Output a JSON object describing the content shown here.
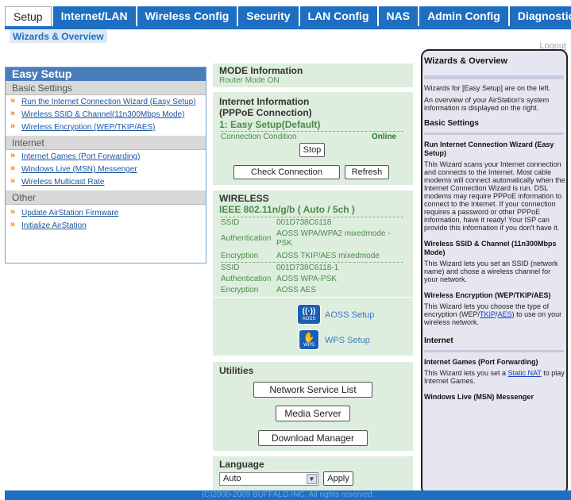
{
  "nav": {
    "tabs": [
      "Setup",
      "Internet/LAN",
      "Wireless Config",
      "Security",
      "LAN Config",
      "NAS",
      "Admin Config",
      "Diagnostic"
    ],
    "active_index": 0,
    "sub_link": "Wizards & Overview",
    "logout": "Logout"
  },
  "easy_setup": {
    "title": "Easy Setup",
    "sections": [
      {
        "title": "Basic Settings",
        "items": [
          "Run the Internet Connection Wizard (Easy Setup)",
          "Wireless SSID & Channel(11n300Mbps Mode)",
          "Wireless Encryption (WEP/TKIP/AES)"
        ]
      },
      {
        "title": "Internet",
        "items": [
          "Internet Games (Port Forwarding)",
          "Windows Live (MSN) Messenger",
          "Wireless Multicast Rate"
        ]
      },
      {
        "title": "Other",
        "items": [
          "Update AirStation Firmware",
          "Initialize AirStation"
        ]
      }
    ]
  },
  "mode": {
    "title": "MODE Information",
    "value": "Router Mode ON"
  },
  "internet": {
    "title_line1": "Internet Information",
    "title_line2": "(PPPoE Connection)",
    "session": "1: Easy Setup(Default)",
    "condition_label": "Connection Condition",
    "condition_value": "Online",
    "stop_button": "Stop",
    "check_button": "Check Connection",
    "refresh_button": "Refresh"
  },
  "wireless": {
    "title": "WIRELESS",
    "mode": "IEEE 802.11n/g/b ( Auto / 5ch )",
    "ssid1_label": "SSID",
    "ssid1": "001D738C6118",
    "auth1_label": "Authentication",
    "auth1": "AOSS WPA/WPA2 mixedmode - PSK",
    "enc1_label": "Encryption",
    "enc1": "AOSS TKIP/AES mixedmode",
    "ssid2_label": "SSID",
    "ssid2": "001D738C6118-1",
    "auth2_label": "Authentication",
    "auth2": "AOSS WPA-PSK",
    "enc2_label": "Encryption",
    "enc2": "AOSS AES",
    "aoss_label": "AOSS Setup",
    "aoss_icon_text": "AOSS",
    "wps_label": "WPS Setup",
    "wps_icon_text": "WPS"
  },
  "utilities": {
    "title": "Utilities",
    "buttons": [
      "Network Service List",
      "Media Server",
      "Download Manager"
    ]
  },
  "language": {
    "title": "Language",
    "selected": "Auto",
    "apply": "Apply"
  },
  "help": {
    "title": "Wizards & Overview",
    "intro1": "Wizards for [Easy Setup] are on the left.",
    "intro2": "An overview of your AirStation's system information is displayed on the right.",
    "basic_heading": "Basic Settings",
    "run_heading": "Run Internet Connection Wizard (Easy Setup)",
    "run_text": "This Wizard scans your Internet connection and connects to the Internet. Most cable modems will connect automatically when the Internet Connection Wizard is run. DSL modems may require PPPoE information to connect to the Internet. If your connection requires a password or other PPPoE information, have it ready! Your ISP can provide this information if you don't have it.",
    "ssid_heading": "Wireless SSID & Channel (11n300Mbps Mode)",
    "ssid_text": "This Wizard lets you set an SSID (network name) and chose a wireless channel for your network.",
    "enc_heading": "Wireless Encryption (WEP/TKIP/AES)",
    "enc_text_a": "This Wizard lets you choose the type of encryption (WEP/",
    "enc_link1": "TKIP",
    "enc_sep": "/",
    "enc_link2": "AES",
    "enc_text_b": ") to use on your wireless network.",
    "internet_heading": "Internet",
    "games_heading": "Internet Games (Port Forwarding)",
    "games_text_a": "This Wizard lets you set a ",
    "games_link": "Static NAT",
    "games_text_b": " to play Internet Games.",
    "msn_heading": "Windows Live (MSN) Messenger"
  },
  "footer": "(C)2000-2009 BUFFALO INC. All rights reserved.",
  "colors": {
    "nav_blue": "#1e6fc1",
    "panel_green": "#deeede",
    "help_bg": "#e6e6f0",
    "arrow_orange": "#f07d00"
  }
}
